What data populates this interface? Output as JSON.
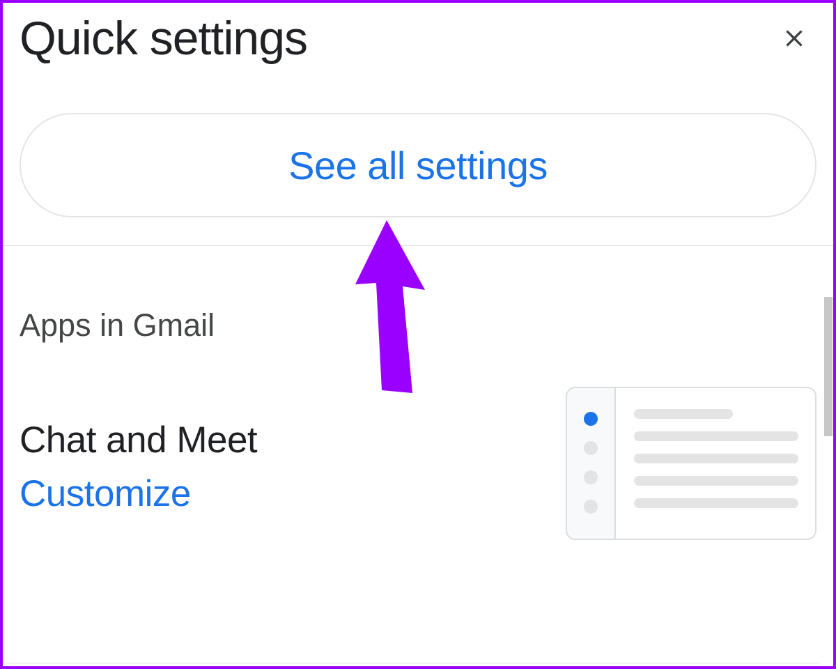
{
  "title": "Quick settings",
  "see_all_label": "See all settings",
  "section": {
    "heading": "Apps in Gmail",
    "option": {
      "title": "Chat and Meet",
      "link": "Customize"
    }
  },
  "colors": {
    "accent": "#1a73e8",
    "annotation": "#9a00ff",
    "border": "#9a00ff"
  }
}
